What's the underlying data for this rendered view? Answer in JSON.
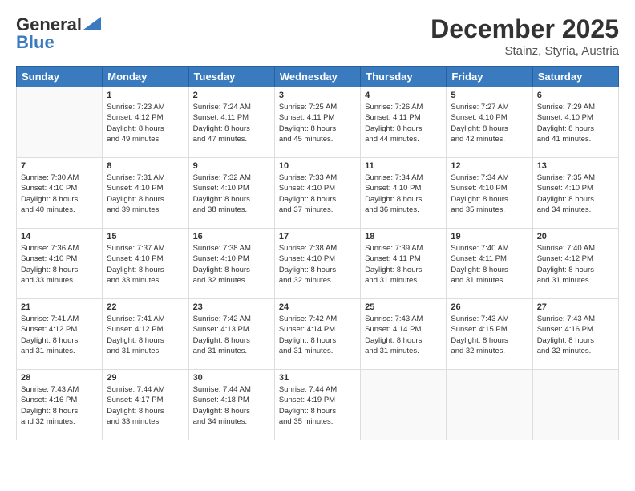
{
  "logo": {
    "general": "General",
    "blue": "Blue"
  },
  "title": "December 2025",
  "subtitle": "Stainz, Styria, Austria",
  "days_header": [
    "Sunday",
    "Monday",
    "Tuesday",
    "Wednesday",
    "Thursday",
    "Friday",
    "Saturday"
  ],
  "weeks": [
    [
      {
        "num": "",
        "info": ""
      },
      {
        "num": "1",
        "info": "Sunrise: 7:23 AM\nSunset: 4:12 PM\nDaylight: 8 hours\nand 49 minutes."
      },
      {
        "num": "2",
        "info": "Sunrise: 7:24 AM\nSunset: 4:11 PM\nDaylight: 8 hours\nand 47 minutes."
      },
      {
        "num": "3",
        "info": "Sunrise: 7:25 AM\nSunset: 4:11 PM\nDaylight: 8 hours\nand 45 minutes."
      },
      {
        "num": "4",
        "info": "Sunrise: 7:26 AM\nSunset: 4:11 PM\nDaylight: 8 hours\nand 44 minutes."
      },
      {
        "num": "5",
        "info": "Sunrise: 7:27 AM\nSunset: 4:10 PM\nDaylight: 8 hours\nand 42 minutes."
      },
      {
        "num": "6",
        "info": "Sunrise: 7:29 AM\nSunset: 4:10 PM\nDaylight: 8 hours\nand 41 minutes."
      }
    ],
    [
      {
        "num": "7",
        "info": "Sunrise: 7:30 AM\nSunset: 4:10 PM\nDaylight: 8 hours\nand 40 minutes."
      },
      {
        "num": "8",
        "info": "Sunrise: 7:31 AM\nSunset: 4:10 PM\nDaylight: 8 hours\nand 39 minutes."
      },
      {
        "num": "9",
        "info": "Sunrise: 7:32 AM\nSunset: 4:10 PM\nDaylight: 8 hours\nand 38 minutes."
      },
      {
        "num": "10",
        "info": "Sunrise: 7:33 AM\nSunset: 4:10 PM\nDaylight: 8 hours\nand 37 minutes."
      },
      {
        "num": "11",
        "info": "Sunrise: 7:34 AM\nSunset: 4:10 PM\nDaylight: 8 hours\nand 36 minutes."
      },
      {
        "num": "12",
        "info": "Sunrise: 7:34 AM\nSunset: 4:10 PM\nDaylight: 8 hours\nand 35 minutes."
      },
      {
        "num": "13",
        "info": "Sunrise: 7:35 AM\nSunset: 4:10 PM\nDaylight: 8 hours\nand 34 minutes."
      }
    ],
    [
      {
        "num": "14",
        "info": "Sunrise: 7:36 AM\nSunset: 4:10 PM\nDaylight: 8 hours\nand 33 minutes."
      },
      {
        "num": "15",
        "info": "Sunrise: 7:37 AM\nSunset: 4:10 PM\nDaylight: 8 hours\nand 33 minutes."
      },
      {
        "num": "16",
        "info": "Sunrise: 7:38 AM\nSunset: 4:10 PM\nDaylight: 8 hours\nand 32 minutes."
      },
      {
        "num": "17",
        "info": "Sunrise: 7:38 AM\nSunset: 4:10 PM\nDaylight: 8 hours\nand 32 minutes."
      },
      {
        "num": "18",
        "info": "Sunrise: 7:39 AM\nSunset: 4:11 PM\nDaylight: 8 hours\nand 31 minutes."
      },
      {
        "num": "19",
        "info": "Sunrise: 7:40 AM\nSunset: 4:11 PM\nDaylight: 8 hours\nand 31 minutes."
      },
      {
        "num": "20",
        "info": "Sunrise: 7:40 AM\nSunset: 4:12 PM\nDaylight: 8 hours\nand 31 minutes."
      }
    ],
    [
      {
        "num": "21",
        "info": "Sunrise: 7:41 AM\nSunset: 4:12 PM\nDaylight: 8 hours\nand 31 minutes."
      },
      {
        "num": "22",
        "info": "Sunrise: 7:41 AM\nSunset: 4:12 PM\nDaylight: 8 hours\nand 31 minutes."
      },
      {
        "num": "23",
        "info": "Sunrise: 7:42 AM\nSunset: 4:13 PM\nDaylight: 8 hours\nand 31 minutes."
      },
      {
        "num": "24",
        "info": "Sunrise: 7:42 AM\nSunset: 4:14 PM\nDaylight: 8 hours\nand 31 minutes."
      },
      {
        "num": "25",
        "info": "Sunrise: 7:43 AM\nSunset: 4:14 PM\nDaylight: 8 hours\nand 31 minutes."
      },
      {
        "num": "26",
        "info": "Sunrise: 7:43 AM\nSunset: 4:15 PM\nDaylight: 8 hours\nand 32 minutes."
      },
      {
        "num": "27",
        "info": "Sunrise: 7:43 AM\nSunset: 4:16 PM\nDaylight: 8 hours\nand 32 minutes."
      }
    ],
    [
      {
        "num": "28",
        "info": "Sunrise: 7:43 AM\nSunset: 4:16 PM\nDaylight: 8 hours\nand 32 minutes."
      },
      {
        "num": "29",
        "info": "Sunrise: 7:44 AM\nSunset: 4:17 PM\nDaylight: 8 hours\nand 33 minutes."
      },
      {
        "num": "30",
        "info": "Sunrise: 7:44 AM\nSunset: 4:18 PM\nDaylight: 8 hours\nand 34 minutes."
      },
      {
        "num": "31",
        "info": "Sunrise: 7:44 AM\nSunset: 4:19 PM\nDaylight: 8 hours\nand 35 minutes."
      },
      {
        "num": "",
        "info": ""
      },
      {
        "num": "",
        "info": ""
      },
      {
        "num": "",
        "info": ""
      }
    ]
  ]
}
